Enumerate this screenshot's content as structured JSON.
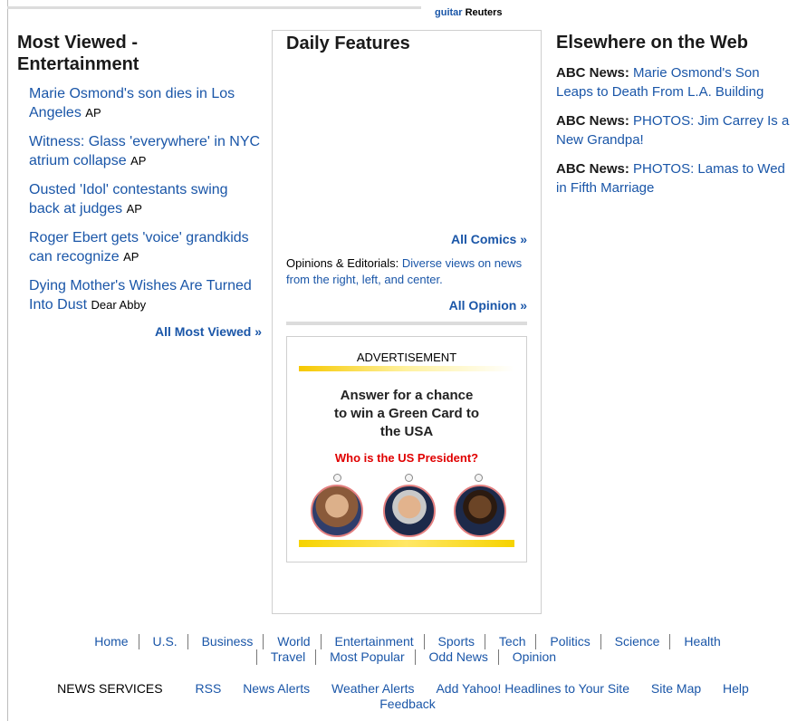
{
  "top": {
    "link": "guitar",
    "source": "Reuters"
  },
  "most_viewed": {
    "title": "Most Viewed - Entertainment",
    "items": [
      {
        "text": "Marie Osmond's son dies in Los Angeles",
        "source": "AP"
      },
      {
        "text": "Witness: Glass 'everywhere' in NYC atrium collapse",
        "source": "AP"
      },
      {
        "text": "Ousted 'Idol' contestants swing back at judges",
        "source": "AP"
      },
      {
        "text": "Roger Ebert gets 'voice' grandkids can recognize",
        "source": "AP"
      },
      {
        "text": "Dying Mother's Wishes Are Turned Into Dust",
        "source": "Dear Abby"
      }
    ],
    "more": "All Most Viewed »"
  },
  "daily": {
    "title": "Daily Features",
    "comics_more": "All Comics »",
    "opinion_label": "Opinions & Editorials:",
    "opinion_link": "Diverse views on news from the right, left, and center.",
    "opinion_more": "All Opinion »"
  },
  "ad": {
    "label": "ADVERTISEMENT",
    "headline": "Answer for a chance to win a Green Card to the USA",
    "question": "Who is the US President?",
    "accent": "#f6d300"
  },
  "elsewhere": {
    "title": "Elsewhere on the Web",
    "items": [
      {
        "source": "ABC News:",
        "text": "Marie Osmond's Son Leaps to Death From L.A. Building"
      },
      {
        "source": "ABC News:",
        "text": "PHOTOS: Jim Carrey Is a New Grandpa!"
      },
      {
        "source": "ABC News:",
        "text": "PHOTOS: Lamas to Wed in Fifth Marriage"
      }
    ]
  },
  "footer_nav": [
    "Home",
    "U.S.",
    "Business",
    "World",
    "Entertainment",
    "Sports",
    "Tech",
    "Politics",
    "Science",
    "Health",
    "Travel",
    "Most Popular",
    "Odd News",
    "Opinion"
  ],
  "services": {
    "heading": "NEWS SERVICES",
    "links": [
      "RSS",
      "News Alerts",
      "Weather Alerts",
      "Add Yahoo! Headlines to Your Site",
      "Site Map",
      "Help",
      "Feedback"
    ]
  },
  "colors": {
    "link": "#1a56a8",
    "ad_question": "#e00000"
  }
}
